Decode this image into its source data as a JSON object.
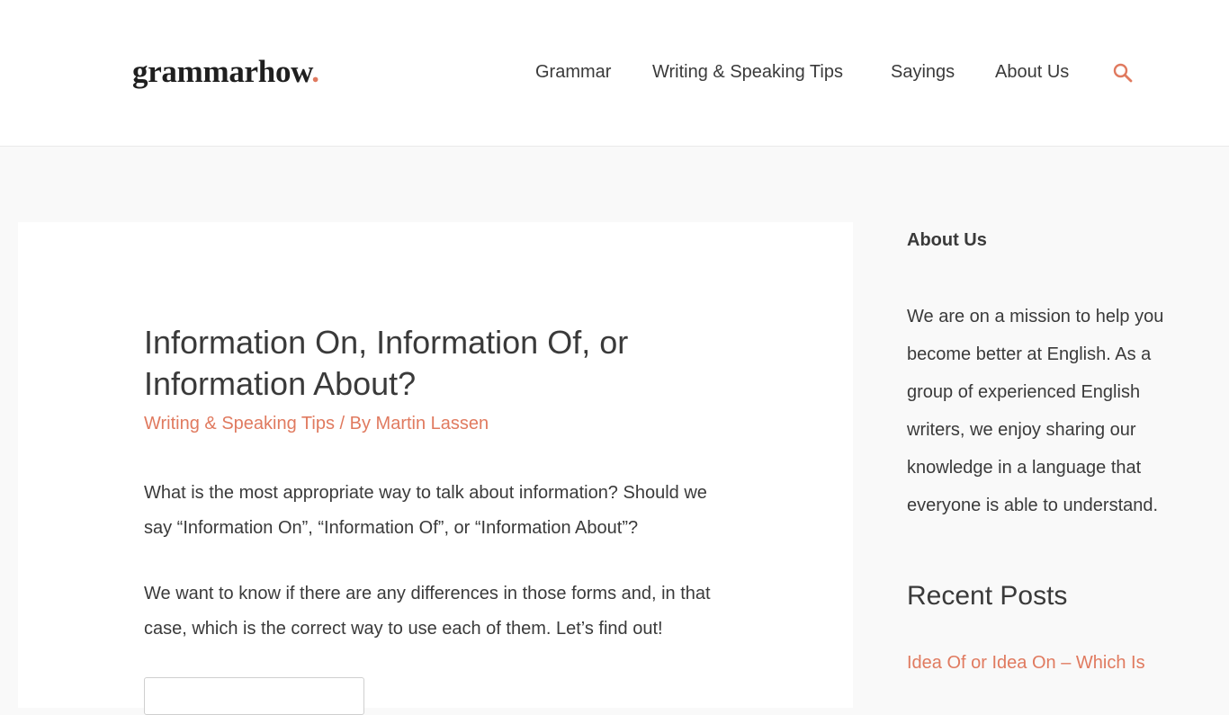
{
  "header": {
    "logo_text": "grammarhow",
    "logo_dot": ".",
    "nav": [
      {
        "label": "Grammar"
      },
      {
        "label": "Writing & Speaking Tips"
      },
      {
        "label": "Sayings"
      },
      {
        "label": "About Us"
      }
    ],
    "search_icon": "search-icon"
  },
  "article": {
    "title": "Information On, Information Of, or Information About?",
    "category": "Writing & Speaking Tips",
    "byline_sep": " / By ",
    "author": "Martin Lassen",
    "paragraphs": [
      "What is the most appropriate way to talk about information? Should we say “Information On”, “Information Of”, or “Information About”?",
      "We want to know if there are any differences in those forms and, in that case, which is the correct way to use each of them. Let’s find out!"
    ]
  },
  "sidebar": {
    "about_title": "About Us",
    "about_text": "We are on a mission to help you become better at English. As a group of experienced English writers, we enjoy sharing our knowledge in a language that everyone is able to understand.",
    "recent_title": "Recent Posts",
    "recent_posts": [
      {
        "label": "Idea Of or Idea On – Which Is"
      }
    ]
  },
  "colors": {
    "accent": "#e07a5f",
    "text": "#3a3a3a",
    "background": "#f9f9f9"
  }
}
